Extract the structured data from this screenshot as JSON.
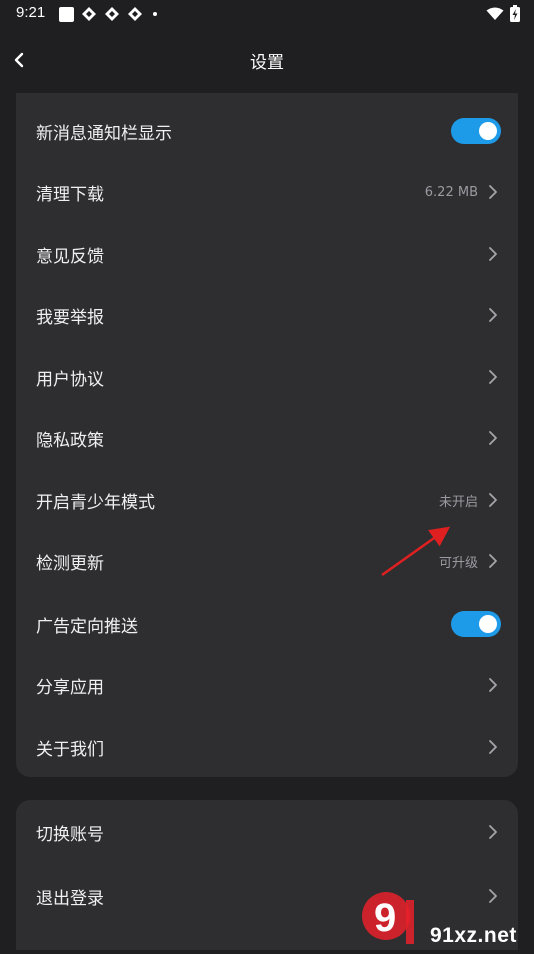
{
  "status_bar": {
    "time": "9:21",
    "notification_icons": [
      "square-icon",
      "diamond-icon",
      "diamond-icon",
      "diamond-icon",
      "dot-icon"
    ],
    "right_icons": [
      "wifi-icon",
      "battery-charging-icon"
    ]
  },
  "header": {
    "title": "设置",
    "back_icon": "chevron-left-icon"
  },
  "settings": {
    "items": [
      {
        "label": "新消息通知栏显示",
        "control": "toggle",
        "toggle_on": true
      },
      {
        "label": "清理下载",
        "value": "6.22 MB",
        "control": "chevron"
      },
      {
        "label": "意见反馈",
        "control": "chevron"
      },
      {
        "label": "我要举报",
        "control": "chevron"
      },
      {
        "label": "用户协议",
        "control": "chevron"
      },
      {
        "label": "隐私政策",
        "control": "chevron"
      },
      {
        "label": "开启青少年模式",
        "value": "未开启",
        "control": "chevron"
      },
      {
        "label": "检测更新",
        "value": "可升级",
        "control": "chevron"
      },
      {
        "label": "广告定向推送",
        "control": "toggle",
        "toggle_on": true
      },
      {
        "label": "分享应用",
        "control": "chevron"
      },
      {
        "label": "关于我们",
        "control": "chevron"
      }
    ]
  },
  "account": {
    "items": [
      {
        "label": "切换账号",
        "control": "chevron"
      },
      {
        "label": "退出登录",
        "control": "chevron"
      }
    ]
  },
  "watermark": {
    "text": "91xz.net",
    "logo_text": "9"
  },
  "colors": {
    "background": "#1f1f21",
    "card": "#2e2e31",
    "toggle_accent": "#1e9be8",
    "annotation_arrow": "#e02020"
  }
}
